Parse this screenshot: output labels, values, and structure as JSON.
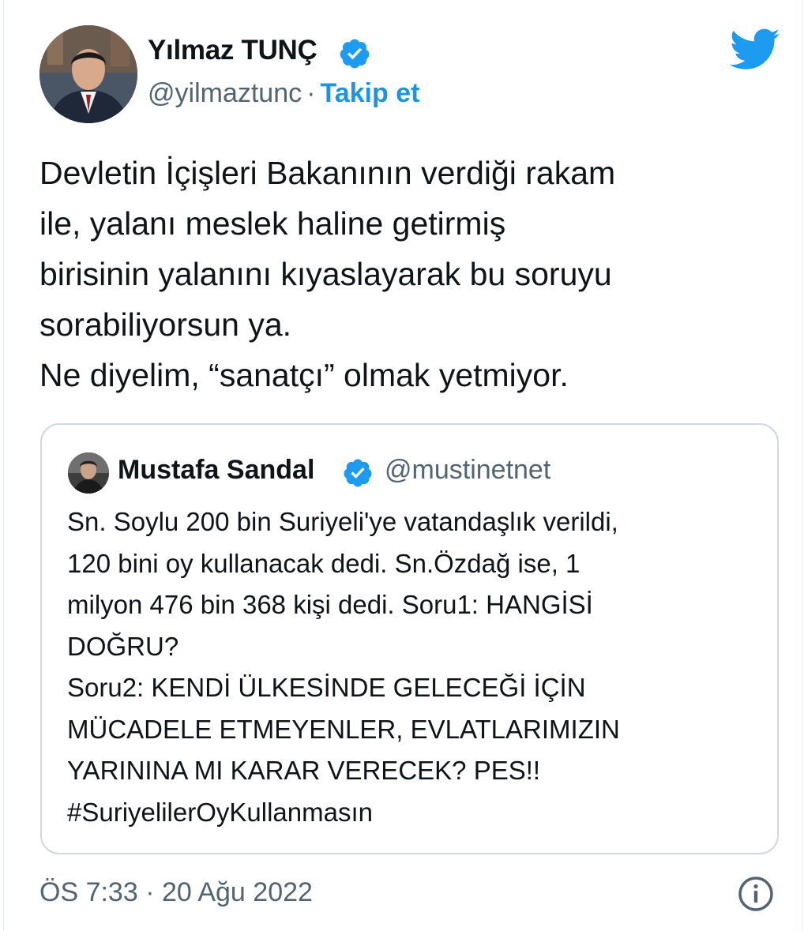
{
  "author": {
    "name": "Yılmaz TUNÇ",
    "handle": "@yilmaztunc",
    "separator": "·",
    "follow_label": "Takip et",
    "avatar_icon": "profile-photo",
    "verified_icon": "verified-badge-icon"
  },
  "brand_icon": "twitter-bird-icon",
  "tweet": {
    "lines": [
      "Devletin İçişleri Bakanının verdiği rakam",
      "ile, yalanı meslek haline getirmiş",
      "birisinin yalanını kıyaslayarak bu soruyu",
      "sorabiliyorsun ya.",
      "Ne diyelim, “sanatçı” olmak yetmiyor."
    ]
  },
  "quoted": {
    "name": "Mustafa Sandal",
    "handle": "@mustinetnet",
    "lines": [
      "Sn. Soylu 200 bin Suriyeli'ye vatandaşlık verildi,",
      "120 bini oy kullanacak dedi. Sn.Özdağ ise, 1",
      "milyon 476 bin 368 kişi dedi. Soru1: HANGİSİ",
      "DOĞRU?",
      "Soru2: KENDİ ÜLKESİNDE GELECEĞİ İÇİN",
      "MÜCADELE ETMEYENLER, EVLATLARIMIZIN",
      "YARININA MI KARAR VERECEK? PES!!",
      "#SuriyelilerOyKullanmasın"
    ]
  },
  "footer": {
    "timestamp": "ÖS 7:33 · 20 Ağu 2022",
    "info_icon": "info-icon"
  },
  "colors": {
    "text": "#0f1419",
    "secondary": "#536471",
    "accent": "#1b95e0",
    "verified": "#1d9bf0",
    "border": "#cfd9de"
  }
}
